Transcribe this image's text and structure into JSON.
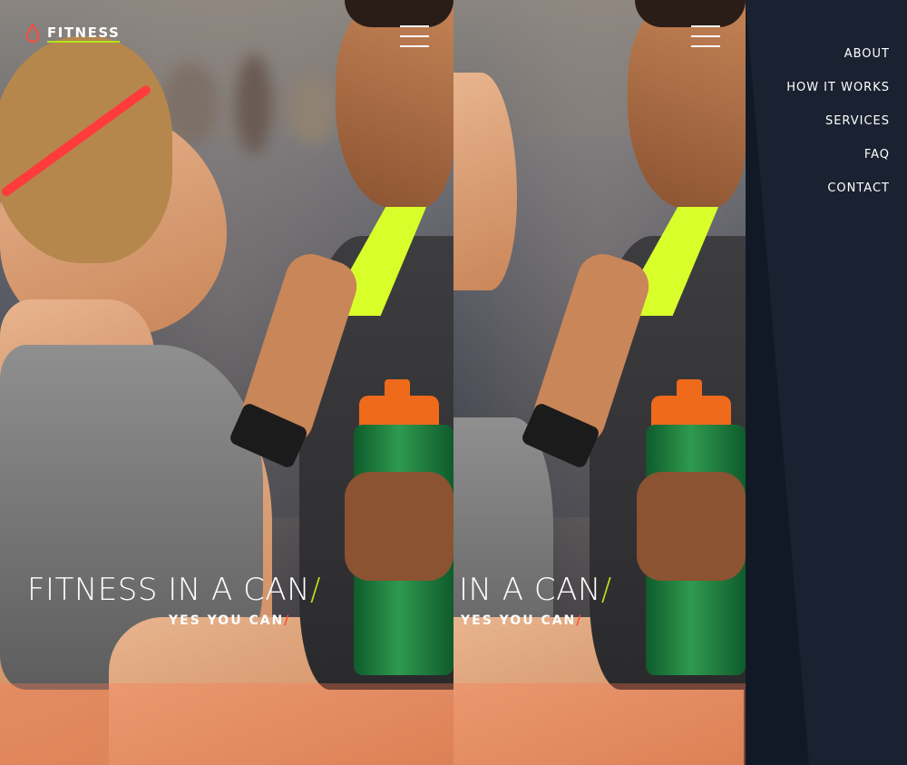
{
  "brand": {
    "name": "FITNESS",
    "accent_green": "#b6e21d",
    "accent_red": "#ff4b3b"
  },
  "hero": {
    "title": "FITNESS IN A CAN",
    "title_mirror": "IN A CAN",
    "slash": "/",
    "subtitle": "YES YOU CAN"
  },
  "icons": {
    "menu": "hamburger-menu-icon",
    "logo": "water-drop-icon"
  },
  "nav": {
    "items": [
      {
        "label": "ABOUT"
      },
      {
        "label": "HOW IT WORKS"
      },
      {
        "label": "SERVICES"
      },
      {
        "label": "FAQ"
      },
      {
        "label": "CONTACT"
      }
    ]
  }
}
